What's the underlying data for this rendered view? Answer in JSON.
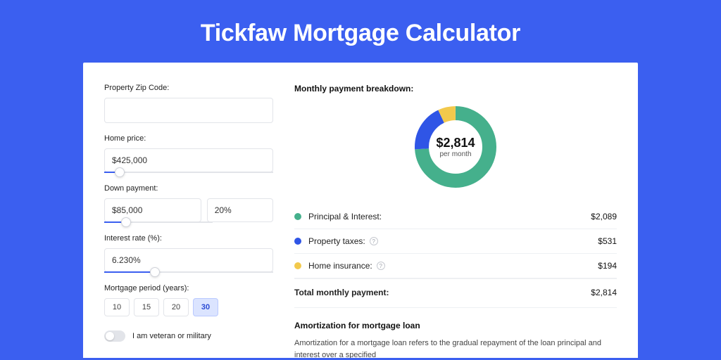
{
  "page_title": "Tickfaw Mortgage Calculator",
  "colors": {
    "principal": "#45b08c",
    "taxes": "#2f55e6",
    "insurance": "#f2c94c"
  },
  "form": {
    "zip_label": "Property Zip Code:",
    "zip_value": "",
    "price_label": "Home price:",
    "price_value": "$425,000",
    "price_slider_pct": 9,
    "down_label": "Down payment:",
    "down_value": "$85,000",
    "down_pct_value": "20%",
    "down_slider_pct": 20,
    "rate_label": "Interest rate (%):",
    "rate_value": "6.230%",
    "rate_slider_pct": 30,
    "period_label": "Mortgage period (years):",
    "period_options": [
      "10",
      "15",
      "20",
      "30"
    ],
    "period_selected_index": 3,
    "veteran_label": "I am veteran or military"
  },
  "breakdown": {
    "title": "Monthly payment breakdown:",
    "donut_amount": "$2,814",
    "donut_sub": "per month",
    "items": [
      {
        "label": "Principal & Interest:",
        "value": "$2,089",
        "color_key": "principal",
        "info": false
      },
      {
        "label": "Property taxes:",
        "value": "$531",
        "color_key": "taxes",
        "info": true
      },
      {
        "label": "Home insurance:",
        "value": "$194",
        "color_key": "insurance",
        "info": true
      }
    ],
    "total_label": "Total monthly payment:",
    "total_value": "$2,814"
  },
  "amortization": {
    "title": "Amortization for mortgage loan",
    "text": "Amortization for a mortgage loan refers to the gradual repayment of the loan principal and interest over a specified"
  },
  "chart_data": {
    "type": "pie",
    "title": "Monthly payment breakdown",
    "series": [
      {
        "name": "Principal & Interest",
        "value": 2089
      },
      {
        "name": "Property taxes",
        "value": 531
      },
      {
        "name": "Home insurance",
        "value": 194
      }
    ],
    "total": 2814,
    "unit": "USD per month"
  }
}
